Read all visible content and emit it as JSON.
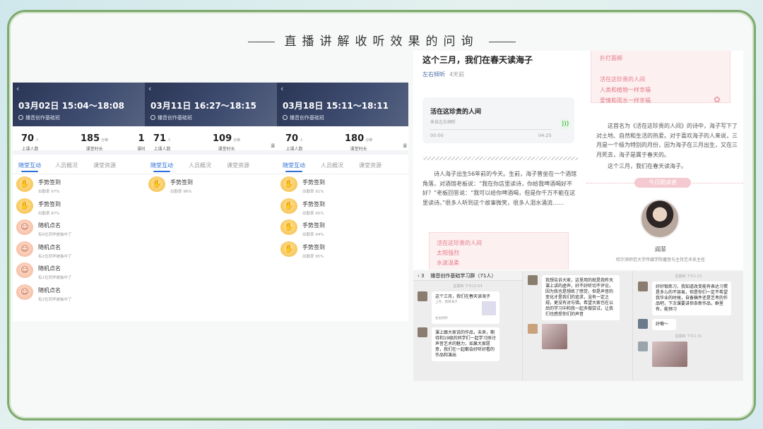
{
  "slide": {
    "title": "直播讲解收听效果的问询"
  },
  "sessions": [
    {
      "time": "03月02日 15:04～18:08",
      "class_name": "播音创作基础班",
      "stats": [
        {
          "num": "70",
          "unit": "人",
          "label": "上课人数"
        },
        {
          "num": "185",
          "unit": "分钟",
          "label": "课堂时长"
        },
        {
          "num": "1",
          "unit": "",
          "label": "课时"
        }
      ],
      "tabs": [
        "随堂互动",
        "人员概况",
        "课堂资源"
      ],
      "items": [
        {
          "title": "手势签到",
          "sub": "出勤率 97%",
          "icon": "sign-in-hand-icon"
        },
        {
          "title": "手势签到",
          "sub": "出勤率 87%",
          "icon": "sign-in-hand-icon"
        },
        {
          "title": "随机点名",
          "sub": "有6位同学被抽中了",
          "icon": "random-rollcall-icon"
        },
        {
          "title": "随机点名",
          "sub": "有2位同学被抽中了",
          "icon": "random-rollcall-icon"
        },
        {
          "title": "随机点名",
          "sub": "有1位同学被抽中了",
          "icon": "random-rollcall-icon"
        },
        {
          "title": "随机点名",
          "sub": "有2位同学被抽中了",
          "icon": "random-rollcall-icon"
        }
      ]
    },
    {
      "time": "03月11日 16:27～18:15",
      "class_name": "播音创作基础班",
      "stats": [
        {
          "num": "71",
          "unit": "人",
          "label": "上课人数"
        },
        {
          "num": "109",
          "unit": "分钟",
          "label": "课堂时长"
        },
        {
          "num": "",
          "unit": "",
          "label": "课"
        }
      ],
      "tabs": [
        "随堂互动",
        "人员概况",
        "课堂资源"
      ],
      "items": [
        {
          "title": "手势签到",
          "sub": "出勤率 96%",
          "icon": "sign-in-hand-icon"
        }
      ]
    },
    {
      "time": "03月18日 15:11～18:11",
      "class_name": "播音创作基础班",
      "stats": [
        {
          "num": "70",
          "unit": "人",
          "label": "上课人数"
        },
        {
          "num": "180",
          "unit": "分钟",
          "label": "课堂时长"
        },
        {
          "num": "",
          "unit": "",
          "label": "课"
        }
      ],
      "tabs": [
        "随堂互动",
        "人员概况",
        "课堂资源"
      ],
      "items": [
        {
          "title": "手势签到",
          "sub": "出勤率 91%",
          "icon": "sign-in-hand-icon"
        },
        {
          "title": "手势签到",
          "sub": "出勤率 95%",
          "icon": "sign-in-hand-icon"
        },
        {
          "title": "手势签到",
          "sub": "出勤率 94%",
          "icon": "sign-in-hand-icon"
        },
        {
          "title": "手势签到",
          "sub": "出勤率 95%",
          "icon": "sign-in-hand-icon"
        }
      ]
    }
  ],
  "article": {
    "title": "这个三月，我们在春天读海子",
    "author": "左右倾听",
    "time_ago": "4天前",
    "audio": {
      "title": "活在这珍贵的人间",
      "source": "来自左右倾听",
      "elapsed": "00:00",
      "duration": "04:25"
    },
    "body": "诗人海子出生56年前的今天。生前，海子曾坐在一个酒馆角落，对酒馆老板说：“我在你店里读诗，你给我啤酒喝好不好？”老板回答说：“我可以给你啤酒喝，但是你千万不能在这里读诗。”很多人听到这个故事微笑，很多人泪水涌流……",
    "card_lines": [
      "活在这珍贵的人间",
      "太阳强烈",
      "水波温柔"
    ],
    "card2_lines": [
      "扑打面颊",
      "",
      "活在这珍贵的人间",
      "人类和植物一样幸福",
      "爱情和雨水一样幸福"
    ],
    "body2": "这首名为《活在这珍贵的人间》的诗中，海子写下了对土地、自然和生活的热爱。对于喜欢海子的人来说，三月是一个极为特别的月份，因为海子在三月出生，又在三月死去，海子是属于春天的。",
    "body3": "这个三月，我们在春天读海子。",
    "banner": "今日朗读者",
    "reader_name": "阎菲",
    "reader_title": "哈尔滨师范大学传媒学院播音与主持艺术系主任"
  },
  "chat": {
    "group_title": "播音创作基础学习群（71人）",
    "back_count": "3",
    "time1": "星期四 下午12:54",
    "share_title": "这个三月，我们在春天读海子",
    "share_sub": "上月，我邮海子",
    "share_src": "左右倾听",
    "msg2": "课上跟大家说的作品，未来，期待和19级的同学们一起学习探讨声音艺术的魅力，如果大家愿意，我们在一起都会好听好看的作品和演出",
    "msg3": "我想告诉大家，这里用的就是我昨天课上讲的虚声，好不好听切不评论，因为我也是想练了感觉，但是声音的变化才是我们的追求，没有一定之规，更没有对与错。希望大家也在以后的学习中和我一起多做尝试，让我们也感受你们的声音",
    "msg4": "好好锻炼习，我知道改变能有表达习惯是多么的不容易，但是你们一定不希望我华业的时候，自备稿件还是艺考的作品吧，下次课要讲但条新作品，群里有，能预习",
    "reply": "好嘞～",
    "time2": "星期四 下午1:23",
    "time3": "星期四 下午1:31"
  }
}
